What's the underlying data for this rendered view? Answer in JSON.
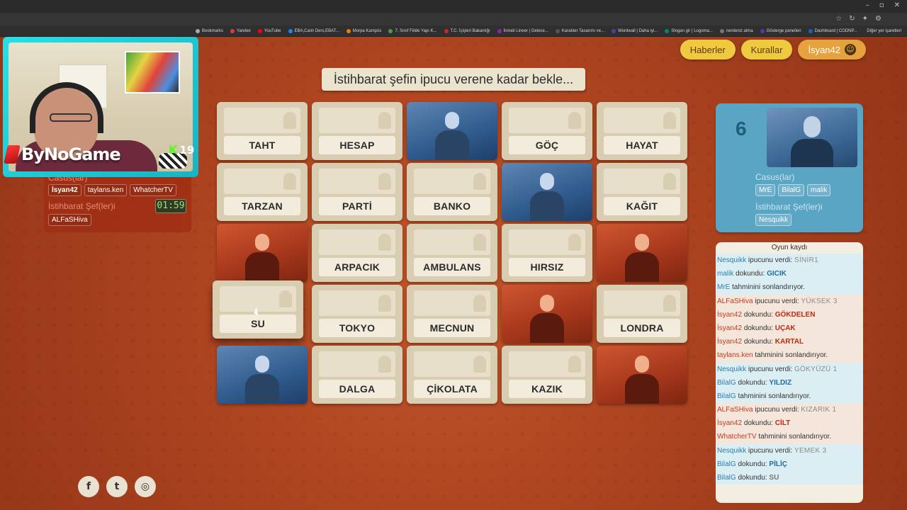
{
  "browser": {
    "bookmarks": [
      {
        "label": "Bookmarks",
        "color": "#aaaaaa"
      },
      {
        "label": "Yandex",
        "color": "#e53935"
      },
      {
        "label": "YouTube",
        "color": "#ff0000"
      },
      {
        "label": "EBA,Canlı Ders,EBAT...",
        "color": "#1e88e5"
      },
      {
        "label": "Morpa Kampüs",
        "color": "#f57c00"
      },
      {
        "label": "7. Sınıf Fiilde Yapı K...",
        "color": "#43a047"
      },
      {
        "label": "T.C. İçişleri Bakanlığı",
        "color": "#c62828"
      },
      {
        "label": "İnmeli Lineer | Gelece...",
        "color": "#8e24aa"
      },
      {
        "label": "Karakter Tasarımı ve...",
        "color": "#6d4c41"
      },
      {
        "label": "Wordwall | Daha iyi...",
        "color": "#3949ab"
      },
      {
        "label": "Slogan gir | Logoma...",
        "color": "#00897b"
      },
      {
        "label": "nerdeniz alma",
        "color": "#757575"
      },
      {
        "label": "Gösterge panelleri",
        "color": "#5e35b1"
      },
      {
        "label": "Dashboard | CODNP...",
        "color": "#1565c0"
      }
    ],
    "other_bookmarks": "Diğer yer işaretleri"
  },
  "streamer": {
    "brand": "ByNoGame",
    "kick_count": "19"
  },
  "red_team": {
    "operatives_label": "Casus(lar)",
    "operatives": [
      "İsyan42",
      "taylans.ken",
      "WhatcherTV"
    ],
    "spymasters_label": "İstihbarat Şef(ler)i",
    "spymasters": [
      "ALFaSHiva"
    ],
    "timer": "01:59"
  },
  "blue_team": {
    "remaining": "6",
    "operatives_label": "Casus(lar)",
    "operatives": [
      "MrE",
      "BilalG",
      "malik"
    ],
    "spymasters_label": "İstihbarat Şef(ler)i",
    "spymasters": [
      "Nesquikk"
    ]
  },
  "header": {
    "news": "Haberler",
    "rules": "Kurallar",
    "user": "İsyan42"
  },
  "banner": "İstihbarat şefin ipucu verene kadar bekle...",
  "board": [
    [
      {
        "type": "word",
        "word": "TAHT"
      },
      {
        "type": "word",
        "word": "HESAP"
      },
      {
        "type": "blue"
      },
      {
        "type": "word",
        "word": "GÖÇ"
      },
      {
        "type": "word",
        "word": "HAYAT"
      }
    ],
    [
      {
        "type": "word",
        "word": "TARZAN"
      },
      {
        "type": "word",
        "word": "PARTİ"
      },
      {
        "type": "word",
        "word": "BANKO"
      },
      {
        "type": "blue"
      },
      {
        "type": "word",
        "word": "KAĞIT"
      }
    ],
    [
      {
        "type": "red"
      },
      {
        "type": "word",
        "word": "ARPACIK"
      },
      {
        "type": "word",
        "word": "AMBULANS"
      },
      {
        "type": "word",
        "word": "HIRSIZ"
      },
      {
        "type": "red"
      }
    ],
    [
      {
        "type": "word",
        "word": "SU",
        "raised": true
      },
      {
        "type": "word",
        "word": "TOKYO"
      },
      {
        "type": "word",
        "word": "MECNUN"
      },
      {
        "type": "red"
      },
      {
        "type": "word",
        "word": "LONDRA"
      }
    ],
    [
      {
        "type": "blue"
      },
      {
        "type": "word",
        "word": "DALGA"
      },
      {
        "type": "word",
        "word": "ÇİKOLATA"
      },
      {
        "type": "word",
        "word": "KAZIK"
      },
      {
        "type": "red"
      }
    ]
  ],
  "log": {
    "title": "Oyun kaydı",
    "entries": [
      {
        "team": "blue",
        "who": "Nesquikk",
        "action": "ipucunu verdi:",
        "hint": "SİNİR1"
      },
      {
        "team": "blue",
        "who": "malik",
        "action": "dokundu:",
        "touch": "GICIK",
        "touch_team": "blue"
      },
      {
        "team": "blue",
        "who": "MrE",
        "action": "tahminini sonlandırıyor."
      },
      {
        "team": "red",
        "who": "ALFaSHiva",
        "action": "ipucunu verdi:",
        "hint": "YÜKSEK 3"
      },
      {
        "team": "red",
        "who": "İsyan42",
        "action": "dokundu:",
        "touch": "GÖKDELEN",
        "touch_team": "red"
      },
      {
        "team": "red",
        "who": "İsyan42",
        "action": "dokundu:",
        "touch": "UÇAK",
        "touch_team": "red"
      },
      {
        "team": "red",
        "who": "İsyan42",
        "action": "dokundu:",
        "touch": "KARTAL",
        "touch_team": "red"
      },
      {
        "team": "red",
        "who": "taylans.ken",
        "action": "tahminini sonlandırıyor."
      },
      {
        "team": "blue",
        "who": "Nesquikk",
        "action": "ipucunu verdi:",
        "hint": "GÖKYÜZÜ 1"
      },
      {
        "team": "blue",
        "who": "BilalG",
        "action": "dokundu:",
        "touch": "YILDIZ",
        "touch_team": "blue"
      },
      {
        "team": "blue",
        "who": "BilalG",
        "action": "tahminini sonlandırıyor."
      },
      {
        "team": "red",
        "who": "ALFaSHiva",
        "action": "ipucunu verdi:",
        "hint": "KIZARIK 1"
      },
      {
        "team": "red",
        "who": "İsyan42",
        "action": "dokundu:",
        "touch": "CİLT",
        "touch_team": "red"
      },
      {
        "team": "red",
        "who": "WhatcherTV",
        "action": "tahminini sonlandırıyor."
      },
      {
        "team": "blue",
        "who": "Nesquikk",
        "action": "ipucunu verdi:",
        "hint": "YEMEK 3"
      },
      {
        "team": "blue",
        "who": "BilalG",
        "action": "dokundu:",
        "touch": "PİLİÇ",
        "touch_team": "blue"
      },
      {
        "team": "blue",
        "who": "BilalG",
        "action": "dokundu:",
        "touch": "SU",
        "touch_team": "neutral"
      }
    ]
  },
  "socials": [
    {
      "name": "facebook-icon",
      "glyph": "f"
    },
    {
      "name": "twitter-icon",
      "glyph": "t"
    },
    {
      "name": "instagram-icon",
      "glyph": "◎"
    }
  ],
  "colors": {
    "red_team": "#c53a1c",
    "blue_team": "#2f7fa8",
    "pill_yellow": "#efc93f",
    "timer_green": "#9be37a"
  }
}
